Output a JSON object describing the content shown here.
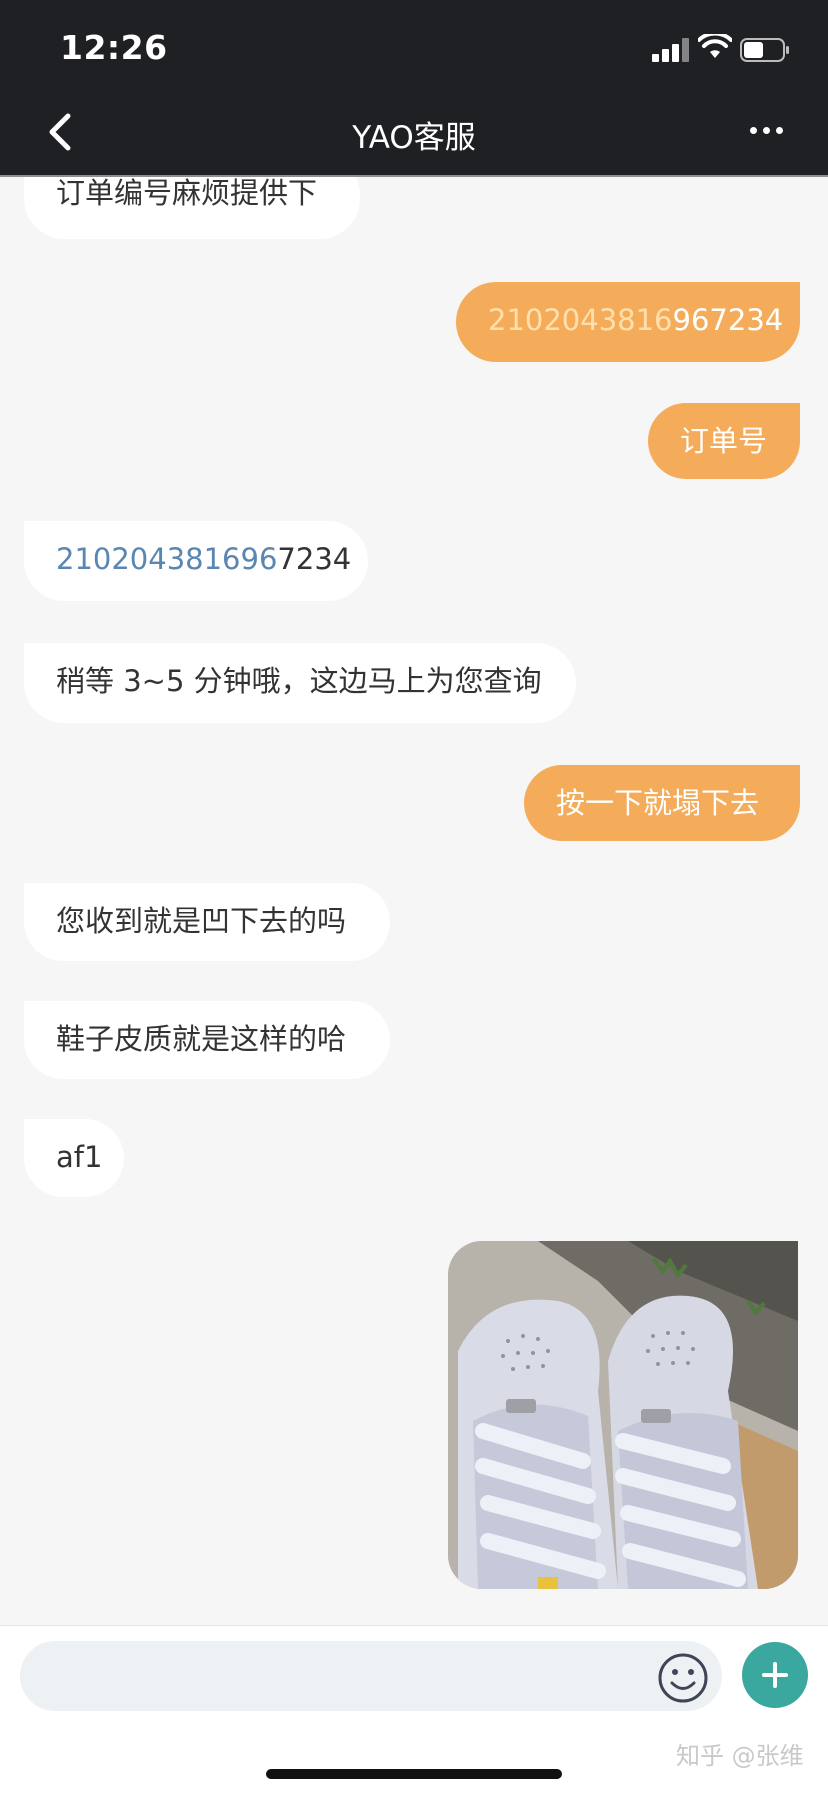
{
  "status_bar": {
    "time": "12:26"
  },
  "header": {
    "title": "YAO客服"
  },
  "messages": [
    {
      "side": "in",
      "text": "订单编号麻烦提供下"
    },
    {
      "side": "out",
      "num_prefix": "2102043816",
      "num_suffix": "967234"
    },
    {
      "side": "out",
      "text": "订单号"
    },
    {
      "side": "in",
      "num_prefix": "210204381696",
      "num_suffix": "7234"
    },
    {
      "side": "in",
      "text": "稍等 3~5 分钟哦，这边马上为您查询"
    },
    {
      "side": "out",
      "text": "按一下就塌下去"
    },
    {
      "side": "in",
      "text": "您收到就是凹下去的吗"
    },
    {
      "side": "in",
      "text": "鞋子皮质就是这样的哈"
    },
    {
      "side": "in",
      "text": "af1"
    },
    {
      "side": "out",
      "type": "image",
      "image": "photo of white sneakers"
    }
  ],
  "input": {
    "placeholder": ""
  },
  "watermark": "知乎 @张维",
  "colors": {
    "outgoing_bubble": "#f4ac5a",
    "incoming_bubble": "#ffffff",
    "accent": "#3aa89f",
    "header_bg": "#1f2024"
  }
}
